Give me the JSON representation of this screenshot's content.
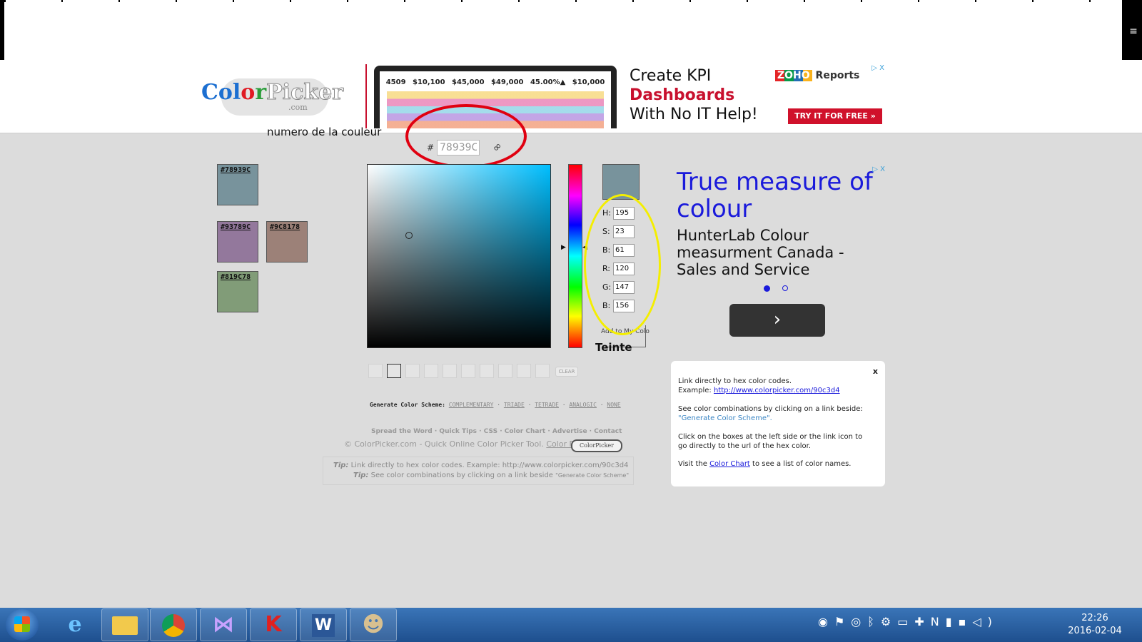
{
  "logo": {
    "text_c1": "Col",
    "text_o": "o",
    "text_r": "r",
    "text_p": "Picker",
    "sub": ".com"
  },
  "ad_top": {
    "kpis": [
      "4509",
      "$10,100",
      "$45,000",
      "$49,000",
      "45.00%▲",
      "$10,000"
    ],
    "line1": "Create KPI",
    "line2": "Dashboards",
    "line3": "With No IT Help!",
    "brand_z": "ZOHO",
    "brand_rest": " Reports",
    "cta": "TRY IT FOR FREE »",
    "close": "▷ X"
  },
  "annotation": "numero de la couleur",
  "hex": {
    "hash": "#",
    "value": "78939C"
  },
  "swatches": [
    {
      "hex": "#78939C",
      "color": "#78939c"
    },
    {
      "hex": "#93789C",
      "color": "#93789c"
    },
    {
      "hex": "#9C8178",
      "color": "#9c8178"
    },
    {
      "hex": "#819C78",
      "color": "#819c78"
    }
  ],
  "fields": {
    "h": {
      "label": "H:",
      "value": "195"
    },
    "s": {
      "label": "S:",
      "value": "23"
    },
    "b": {
      "label": "B:",
      "value": "61"
    },
    "r": {
      "label": "R:",
      "value": "120"
    },
    "g": {
      "label": "G:",
      "value": "147"
    },
    "b2": {
      "label": "B:",
      "value": "156"
    }
  },
  "add_favorite": "Add to My Colo",
  "teinte": "Teinte",
  "clear": "CLEAR",
  "scheme": {
    "label": "Generate Color Scheme:",
    "links": [
      "COMPLEMENTARY",
      "TRIADE",
      "TETRADE",
      "ANALOGIC",
      "NONE"
    ]
  },
  "footer": {
    "links": "Spread the Word · Quick Tips · CSS · Color Chart · Advertise · Contact",
    "copyright": "© ColorPicker.com - Quick Online Color Picker Tool.",
    "cp_link": "Color Picker",
    "badge": "ColorPicker"
  },
  "tipbox": {
    "tip1_label": "Tip:",
    "tip1": "Link directly to hex color codes.   Example:  http://www.colorpicker.com/90c3d4",
    "tip2_label": "Tip:",
    "tip2": "See color combinations by clicking on a link beside",
    "tip2_small": "\"Generate Color Scheme\""
  },
  "ad_right": {
    "title": "True measure of colour",
    "body": "HunterLab Colour measurment Canada - Sales and Service",
    "next": "›",
    "close": "▷ X"
  },
  "tip_panel": {
    "close": "x",
    "p1a": "Link directly to hex color codes.",
    "p1b": "Example: ",
    "p1link": "http://www.colorpicker.com/90c3d4",
    "p2a": "See color combinations by clicking on a link beside:",
    "p2q": "\"Generate Color Scheme\".",
    "p3": "Click on the boxes at the left side or the link icon to go directly to the url of the hex color.",
    "p4a": "Visit the ",
    "p4link": "Color Chart",
    "p4b": " to see a list of color names."
  },
  "taskbar": {
    "apps": [
      "internet-explorer",
      "file-explorer",
      "chrome",
      "visual-studio",
      "kaspersky",
      "word",
      "gimp"
    ],
    "time": "22:26",
    "date": "2016-02-04"
  }
}
